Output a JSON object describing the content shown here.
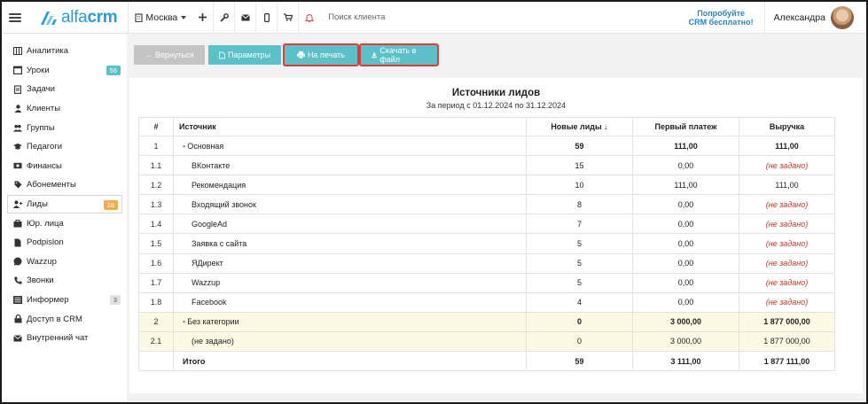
{
  "topbar": {
    "branch": "Москва",
    "search_placeholder": "Поиск клиента",
    "try_crm_line1": "Попробуйте",
    "try_crm_line2": "CRM бесплатно!",
    "user_name": "Александра"
  },
  "sidebar": {
    "items": [
      {
        "label": "Аналитика",
        "icon": "analytics-icon"
      },
      {
        "label": "Уроки",
        "icon": "calendar-icon",
        "badge": "56"
      },
      {
        "label": "Задачи",
        "icon": "tasks-icon"
      },
      {
        "label": "Клиенты",
        "icon": "user-icon"
      },
      {
        "label": "Группы",
        "icon": "group-icon"
      },
      {
        "label": "Педагоги",
        "icon": "graduation-icon"
      },
      {
        "label": "Финансы",
        "icon": "money-icon"
      },
      {
        "label": "Абонементы",
        "icon": "tag-icon"
      },
      {
        "label": "Лиды",
        "icon": "lead-icon",
        "badge": "18"
      },
      {
        "label": "Юр. лица",
        "icon": "briefcase-icon"
      },
      {
        "label": "Podpislon",
        "icon": "document-icon"
      },
      {
        "label": "Wazzup",
        "icon": "chat-icon"
      },
      {
        "label": "Звонки",
        "icon": "phone-icon"
      },
      {
        "label": "Информер",
        "icon": "list-icon",
        "badge": "3"
      },
      {
        "label": "Доступ в CRM",
        "icon": "lock-icon"
      },
      {
        "label": "Внутренний чат",
        "icon": "envelope-icon"
      }
    ]
  },
  "toolbar": {
    "back": "← Вернуться",
    "params": "Параметры",
    "print": "На печать",
    "download": "Скачать в файл"
  },
  "report": {
    "title": "Источники лидов",
    "subtitle": "За период с 01.12.2024 по 31.12.2024",
    "columns": [
      "#",
      "Источник",
      "Новые лиды ↓",
      "Первый платеж",
      "Выручка"
    ],
    "rows": [
      {
        "num": "1",
        "source": "Основная",
        "leads": "59",
        "first_payment": "111,00",
        "revenue": "111,00"
      },
      {
        "num": "1.1",
        "source": "ВКонтакте",
        "leads": "15",
        "first_payment": "0,00",
        "revenue": "(не задано)"
      },
      {
        "num": "1.2",
        "source": "Рекомендация",
        "leads": "10",
        "first_payment": "111,00",
        "revenue": "111,00"
      },
      {
        "num": "1.3",
        "source": "Входящий звонок",
        "leads": "8",
        "first_payment": "0,00",
        "revenue": "(не задано)"
      },
      {
        "num": "1.4",
        "source": "GoogleAd",
        "leads": "7",
        "first_payment": "0,00",
        "revenue": "(не задано)"
      },
      {
        "num": "1.5",
        "source": "Заявка с сайта",
        "leads": "5",
        "first_payment": "0,00",
        "revenue": "(не задано)"
      },
      {
        "num": "1.6",
        "source": "ЯДирект",
        "leads": "5",
        "first_payment": "0,00",
        "revenue": "(не задано)"
      },
      {
        "num": "1.7",
        "source": "Wazzup",
        "leads": "5",
        "first_payment": "0,00",
        "revenue": "(не задано)"
      },
      {
        "num": "1.8",
        "source": "Facebook",
        "leads": "4",
        "first_payment": "0,00",
        "revenue": "(не задано)"
      },
      {
        "num": "2",
        "source": "Без категории",
        "leads": "0",
        "first_payment": "3 000,00",
        "revenue": "1 877 000,00"
      },
      {
        "num": "2.1",
        "source": "(не задано)",
        "leads": "0",
        "first_payment": "3 000,00",
        "revenue": "1 877 000,00"
      }
    ],
    "total": {
      "label": "Итого",
      "leads": "59",
      "first_payment": "3 111,00",
      "revenue": "1 877 111,00"
    }
  }
}
